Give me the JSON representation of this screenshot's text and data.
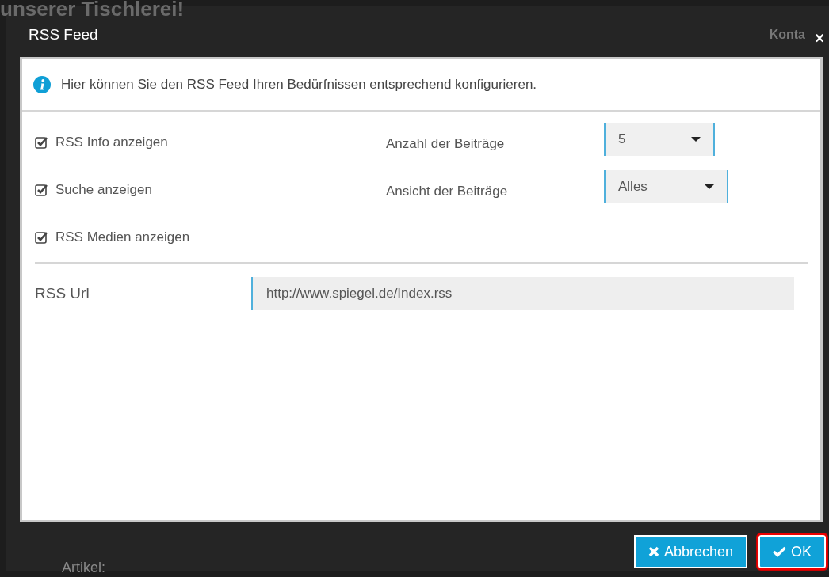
{
  "background": {
    "heading": "unserer Tischlerei!",
    "nav_text": "Konta",
    "label": "Artikel:"
  },
  "dialog": {
    "title": "RSS Feed",
    "close": "×",
    "info": "Hier können Sie den RSS Feed Ihren Bedürfnissen entsprechend konfigurieren.",
    "options": [
      {
        "label": "RSS Info anzeigen",
        "checked": true
      },
      {
        "label": "Suche anzeigen",
        "checked": true
      },
      {
        "label": "RSS Medien anzeigen",
        "checked": true
      }
    ],
    "settings": [
      {
        "label": "Anzahl der Beiträge",
        "value": "5"
      },
      {
        "label": "Ansicht der Beiträge",
        "value": "Alles"
      }
    ],
    "url": {
      "label": "RSS Url",
      "value": "http://www.spiegel.de/Index.rss"
    },
    "buttons": [
      {
        "label": "Abbrechen",
        "kind": "cancel",
        "focused": false
      },
      {
        "label": "OK",
        "kind": "ok",
        "focused": true
      }
    ]
  }
}
